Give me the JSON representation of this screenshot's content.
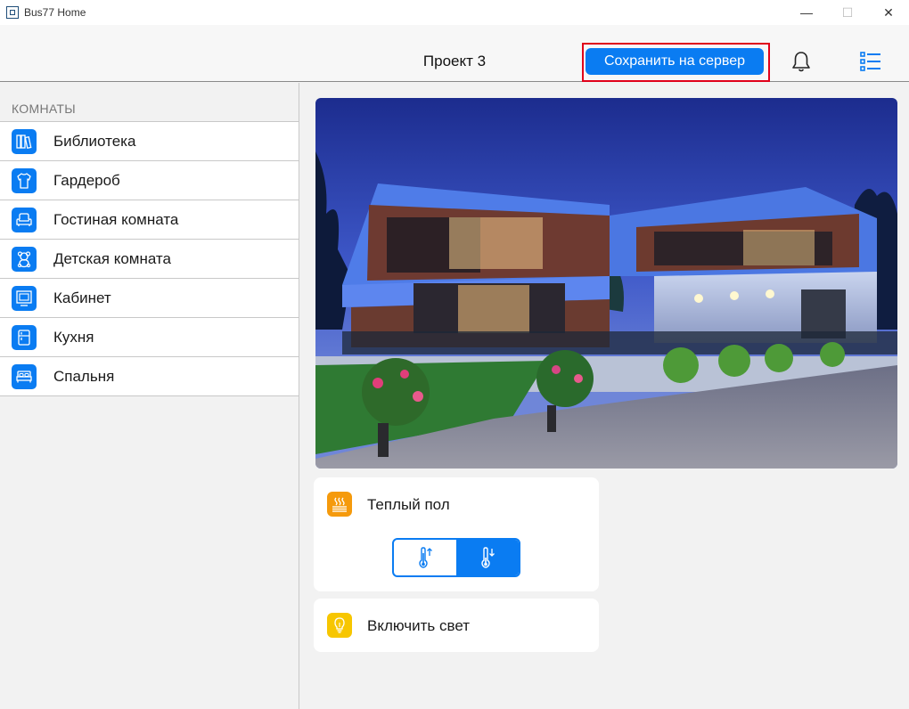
{
  "window": {
    "title": "Bus77 Home",
    "controls": {
      "minimize": "—",
      "maximize": "☐",
      "close": "✕"
    }
  },
  "header": {
    "project_title": "Проект 3",
    "save_button": "Сохранить на сервер",
    "icons": [
      "bell-icon",
      "list-menu-icon"
    ]
  },
  "sidebar": {
    "heading": "КОМНАТЫ",
    "rooms": [
      {
        "label": "Библиотека",
        "icon": "library-books-icon"
      },
      {
        "label": "Гардероб",
        "icon": "shirt-icon"
      },
      {
        "label": "Гостиная комната",
        "icon": "armchair-icon"
      },
      {
        "label": "Детская комната",
        "icon": "teddy-bear-icon"
      },
      {
        "label": "Кабинет",
        "icon": "monitor-icon"
      },
      {
        "label": "Кухня",
        "icon": "fridge-icon"
      },
      {
        "label": "Спальня",
        "icon": "bed-icon"
      }
    ]
  },
  "main": {
    "image": "house-photo",
    "controls": [
      {
        "label": "Теплый пол",
        "icon": "floor-heating-icon",
        "segments": [
          {
            "icon": "thermometer-up-icon",
            "active": false
          },
          {
            "icon": "thermometer-down-icon",
            "active": true
          }
        ]
      },
      {
        "label": "Включить свет",
        "icon": "light-bulb-icon"
      }
    ]
  },
  "colors": {
    "accent": "#0a7cf2",
    "highlight": "#e0001a",
    "heating": "#f59a0c",
    "light": "#f7c600"
  }
}
